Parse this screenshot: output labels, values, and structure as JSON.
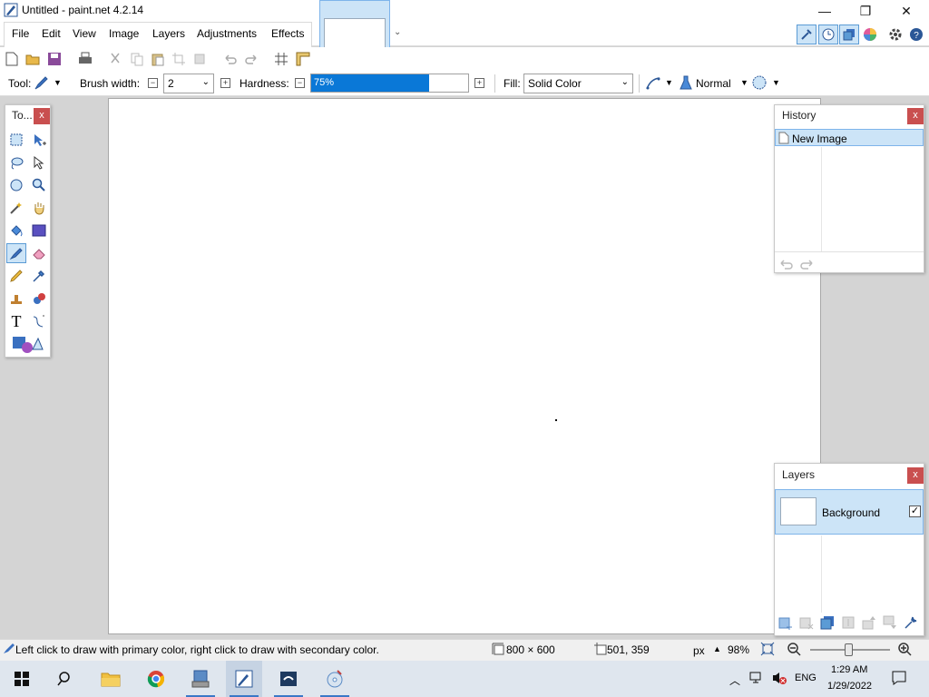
{
  "window": {
    "title": "Untitled - paint.net 4.2.14",
    "minimize": "—",
    "maximize": "❐",
    "close": "✕"
  },
  "menu": [
    "File",
    "Edit",
    "View",
    "Image",
    "Layers",
    "Adjustments",
    "Effects"
  ],
  "toolbar": {
    "tool_label": "Tool:",
    "brush_width_label": "Brush width:",
    "brush_width_value": "2",
    "hardness_label": "Hardness:",
    "hardness_value": "75%",
    "hardness_fraction": 0.75,
    "fill_label": "Fill:",
    "fill_value": "Solid Color",
    "blend_mode": "Normal"
  },
  "tools_panel": {
    "title": "To...",
    "close": "x",
    "tools": [
      "rectangle-select-icon",
      "move-selection-icon",
      "lasso-select-icon",
      "move-selected-icon",
      "ellipse-select-icon",
      "zoom-icon",
      "magic-wand-icon",
      "pan-icon",
      "paint-bucket-icon",
      "gradient-icon",
      "paintbrush-icon",
      "eraser-icon",
      "pencil-icon",
      "color-picker-icon",
      "clone-stamp-icon",
      "recolor-icon",
      "text-icon",
      "line-curve-icon",
      "shapes-icon"
    ],
    "text_glyph": "T"
  },
  "history_panel": {
    "title": "History",
    "close": "x",
    "items": [
      "New Image"
    ]
  },
  "layers_panel": {
    "title": "Layers",
    "close": "x",
    "layers": [
      {
        "name": "Background",
        "visible": true
      }
    ]
  },
  "status": {
    "hint": "Left click to draw with primary color, right click to draw with secondary color.",
    "image_size": "800 × 600",
    "cursor_pos": "501, 359",
    "unit": "px",
    "zoom": "98%"
  },
  "taskbar": {
    "language": "ENG",
    "time": "1:29 AM",
    "date": "1/29/2022"
  },
  "colors": {
    "accent": "#0a78d7",
    "selection": "#cce4f7",
    "panel_close": "#c94f4f"
  }
}
